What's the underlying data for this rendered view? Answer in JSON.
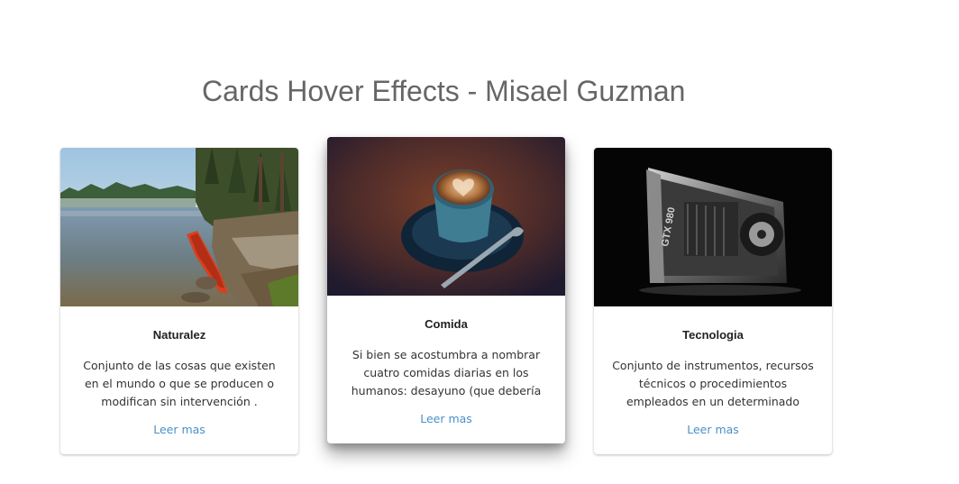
{
  "page": {
    "title": "Cards Hover Effects - Misael Guzman"
  },
  "cards": [
    {
      "title": "Naturalez",
      "text": "Conjunto de las cosas que existen en el mundo o que se producen o modifican sin intervención .",
      "link": "Leer mas",
      "image_icon": "lake-canoe-image",
      "hovered": false
    },
    {
      "title": "Comida",
      "text": "Si bien se acostumbra a nombrar cuatro comidas diarias en los humanos: desayuno (que debería ser.",
      "link": "Leer mas",
      "image_icon": "coffee-cup-image",
      "hovered": true
    },
    {
      "title": "Tecnologia",
      "text": "Conjunto de instrumentos, recursos técnicos o procedimientos empleados en un determinado campo o sector.",
      "link": "Leer mas",
      "image_icon": "graphics-card-image",
      "image_text": "GTX 980",
      "hovered": false
    }
  ],
  "colors": {
    "title": "#666666",
    "link": "#4a90c8",
    "card_background": "#ffffff"
  }
}
